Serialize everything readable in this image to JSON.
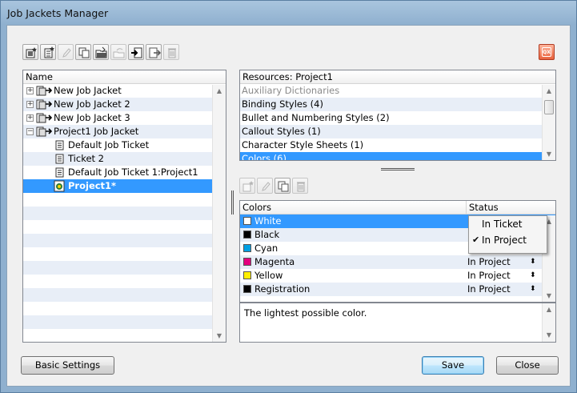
{
  "window": {
    "title": "Job Jackets Manager"
  },
  "toolbar": {
    "buttons": [
      {
        "icon": "new-job-jacket-icon"
      },
      {
        "icon": "new-ticket-icon"
      },
      {
        "icon": "edit-pencil-icon"
      },
      {
        "icon": "duplicate-icon"
      },
      {
        "icon": "open-folder-icon"
      },
      {
        "icon": "revert-icon"
      },
      {
        "icon": "import-icon"
      },
      {
        "icon": "export-icon"
      },
      {
        "icon": "trash-icon"
      }
    ],
    "quark_icon": "QX"
  },
  "tree": {
    "header": "Name",
    "items": [
      {
        "label": "New Job Jacket",
        "level": 0,
        "expander": "+"
      },
      {
        "label": "New Job Jacket 2",
        "level": 0,
        "expander": "+"
      },
      {
        "label": "New Job Jacket 3",
        "level": 0,
        "expander": "+"
      },
      {
        "label": "Project1 Job Jacket",
        "level": 0,
        "expander": "−"
      },
      {
        "label": "Default Job Ticket",
        "level": 1
      },
      {
        "label": "Ticket 2",
        "level": 1
      },
      {
        "label": "Default Job Ticket 1:Project1",
        "level": 1
      },
      {
        "label": "Project1*",
        "level": 1,
        "selected": true
      }
    ]
  },
  "resources": {
    "header": "Resources: Project1",
    "items": [
      {
        "label": "Auxiliary Dictionaries",
        "dim": true
      },
      {
        "label": "Binding Styles (4)"
      },
      {
        "label": "Bullet and Numbering Styles (2)"
      },
      {
        "label": "Callout Styles (1)"
      },
      {
        "label": "Character Style Sheets (1)"
      },
      {
        "label": "Colors (6)",
        "selected": true
      }
    ]
  },
  "colors_table": {
    "col_colors": "Colors",
    "col_status": "Status",
    "rows": [
      {
        "name": "White",
        "swatch": "#ffffff",
        "status": "",
        "selected": true
      },
      {
        "name": "Black",
        "swatch": "#000000",
        "status": ""
      },
      {
        "name": "Cyan",
        "swatch": "#00a0e3",
        "status": ""
      },
      {
        "name": "Magenta",
        "swatch": "#e4007f",
        "status": "In Project"
      },
      {
        "name": "Yellow",
        "swatch": "#ffee00",
        "status": "In Project"
      },
      {
        "name": "Registration",
        "swatch": "#000000",
        "status": "In Project"
      }
    ]
  },
  "status_popup": {
    "options": [
      "In Ticket",
      "In Project"
    ],
    "checked": "In Project"
  },
  "description": "The lightest possible color.",
  "buttons": {
    "basic_settings": "Basic Settings",
    "save": "Save",
    "close": "Close"
  },
  "colors": {
    "selection": "#3399ff",
    "alt_row": "#e8eef7"
  }
}
